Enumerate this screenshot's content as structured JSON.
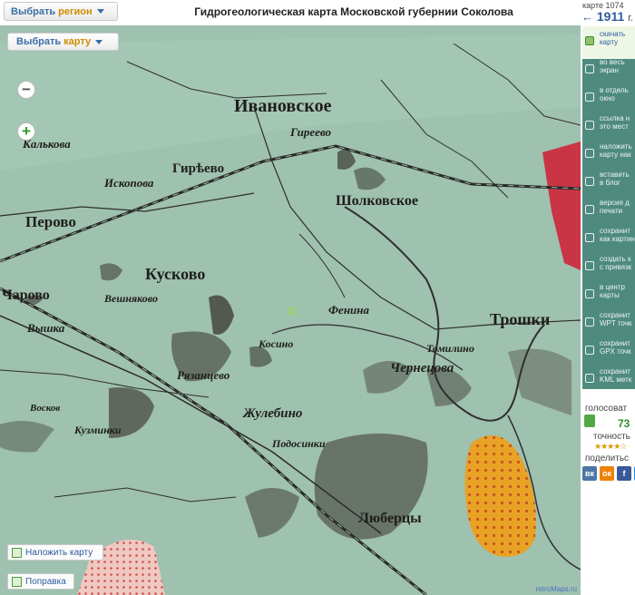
{
  "header": {
    "region_button": {
      "prefix": "Выбрать",
      "highlight": "регион"
    },
    "title": "Гидрогеологическая карта Московской губернии Соколова"
  },
  "map": {
    "select_button": {
      "prefix": "Выбрать",
      "highlight": "карту"
    },
    "zoom_in": "+",
    "zoom_out": "−",
    "overlay_button": "Наложить карту",
    "edit_button": "Поправка",
    "credit": "retroMaps.ru",
    "labels": {
      "ivanovskoe": "Ивановское",
      "gireevo": "Гиреево",
      "gireevo2": "Гирѣево",
      "kalikova": "Калькова",
      "iskopova": "Ископова",
      "perovo": "Перово",
      "kuskovo": "Кусково",
      "veshnyakovo": "Вешняково",
      "charovo": "Чарово",
      "sholkovo": "Шолковское",
      "vyshka": "Вышка",
      "troshki": "Трошки",
      "kosino": "Косино",
      "zhulebino": "Жулебино",
      "lyuberci": "Люберцы",
      "tomilino": "Томилино",
      "kuzminki": "Кузминки",
      "podosinki": "Подосинки",
      "fenina": "Фенина",
      "ryazantsevo": "Рязанцево",
      "chernetsova": "Чернецова",
      "voskov": "Восков"
    }
  },
  "sidebar": {
    "map_number": "карте 1074",
    "year_arrow": "←",
    "year": "1911",
    "year_suffix": "г.",
    "tools": [
      {
        "icon": "download-icon",
        "label": "скачать\nкарту"
      },
      {
        "icon": "fullscreen-icon",
        "label": "во весь\nэкран"
      },
      {
        "icon": "window-icon",
        "label": "в отдель\nокно"
      },
      {
        "icon": "cursor-icon",
        "label": "ссылка н\nэто мест"
      },
      {
        "icon": "overlay-icon",
        "label": "наложить\nкарту нак"
      },
      {
        "icon": "pencil-icon",
        "label": "вставить\nв блог"
      },
      {
        "icon": "print-icon",
        "label": "версия д\nпечати"
      },
      {
        "icon": "save-icon",
        "label": "сохранит\nкак картин"
      },
      {
        "icon": "grid-icon",
        "label": "создать к\nс привязк"
      },
      {
        "icon": "crosshair-icon",
        "label": "в центр\nкарты"
      },
      {
        "icon": "wpt-icon",
        "label": "сохранит\nWPT точк"
      },
      {
        "icon": "gpx-icon",
        "label": "сохранит\nGPX точк"
      },
      {
        "icon": "kml-icon",
        "label": "сохранит\nKML метк"
      }
    ],
    "votes_label": "голосоват",
    "votes_count": "73",
    "accuracy_label": "точность",
    "accuracy_stars": "★★★★☆",
    "share_label": "поделитьс",
    "social": [
      {
        "name": "vk",
        "text": "вк",
        "color": "#4c75a3"
      },
      {
        "name": "ok",
        "text": "ок",
        "color": "#ee8208"
      },
      {
        "name": "fb",
        "text": "f",
        "color": "#3b5998"
      },
      {
        "name": "mail",
        "text": "@",
        "color": "#168de2"
      }
    ]
  }
}
